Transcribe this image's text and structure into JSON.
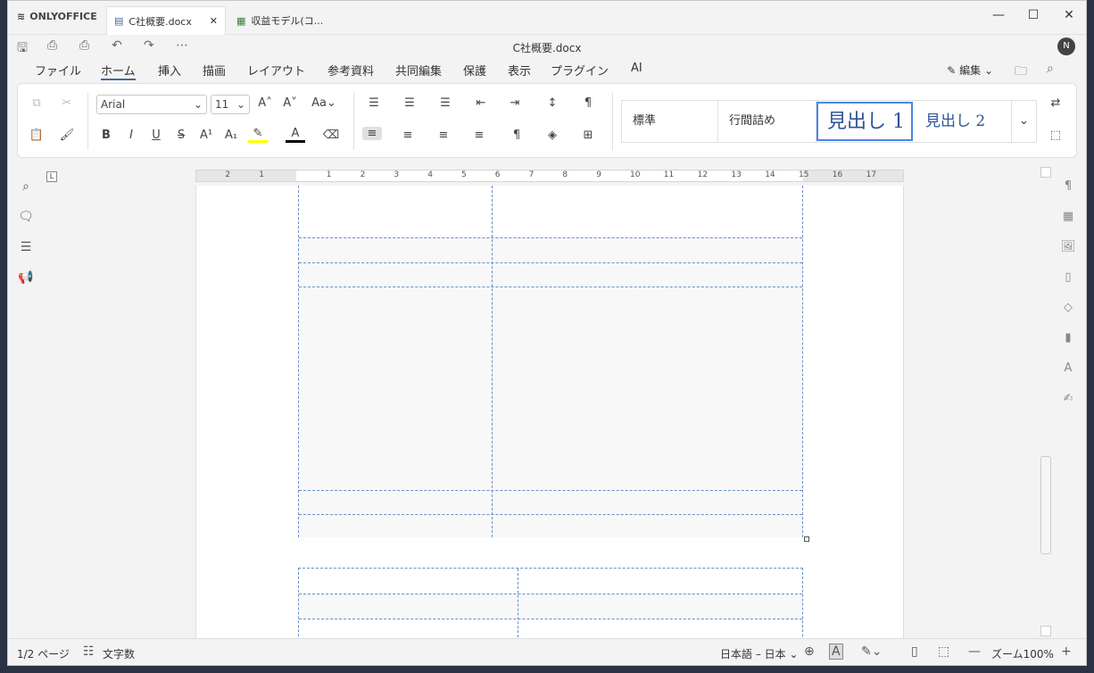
{
  "app": {
    "logo": "ONLYOFFICE"
  },
  "tabs": [
    {
      "label": "C社概要.docx"
    },
    {
      "label": "収益モデル(コ..."
    }
  ],
  "window": {
    "doc_title": "C社概要.docx",
    "avatar": "N"
  },
  "menu": {
    "items": [
      "ファイル",
      "ホーム",
      "挿入",
      "描画",
      "レイアウト",
      "参考資料",
      "共同編集",
      "保護",
      "表示",
      "プラグイン",
      "AI"
    ],
    "active": "ホーム",
    "edit_mode": "編集"
  },
  "ribbon": {
    "font_name": "Arial",
    "font_size": "11",
    "styles": [
      "標準",
      "行間詰め",
      "見出し 1",
      "見出し 2"
    ]
  },
  "ruler": {
    "labels": [
      "2",
      "1",
      "1",
      "2",
      "3",
      "4",
      "5",
      "6",
      "7",
      "8",
      "9",
      "10",
      "11",
      "12",
      "13",
      "14",
      "15",
      "16",
      "17"
    ]
  },
  "status": {
    "page": "1/2 ページ",
    "word_count": "文字数",
    "language": "日本語 – 日本",
    "zoom": "ズーム100%"
  },
  "colors": {
    "highlight": "#ffff00",
    "font_color": "#000000",
    "accent": "#446995"
  }
}
